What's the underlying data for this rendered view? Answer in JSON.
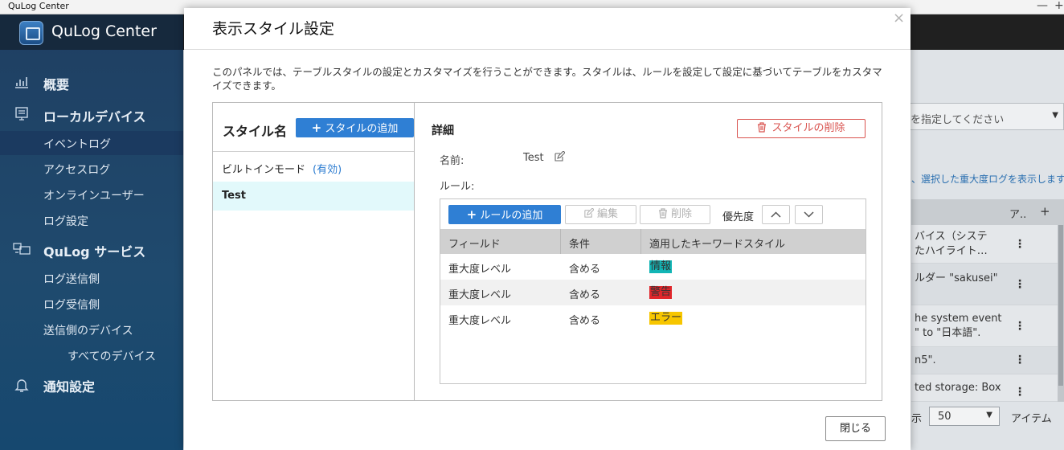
{
  "window": {
    "title": "QuLog Center",
    "minimize": "—",
    "maximize": "+"
  },
  "app": {
    "name": "QuLog Center"
  },
  "sidebar": {
    "groups": [
      {
        "label": "概要",
        "icon": "bar-chart-icon"
      },
      {
        "label": "ローカルデバイス",
        "icon": "local-device-icon"
      },
      {
        "label": "QuLog サービス",
        "icon": "qulog-service-icon"
      },
      {
        "label": "通知設定",
        "icon": "bell-icon"
      }
    ],
    "items": [
      {
        "label": "イベントログ"
      },
      {
        "label": "アクセスログ"
      },
      {
        "label": "オンラインユーザー"
      },
      {
        "label": "ログ設定"
      },
      {
        "label": "ログ送信側"
      },
      {
        "label": "ログ受信側"
      },
      {
        "label": "送信側のデバイス"
      },
      {
        "label": "すべてのデバイス"
      }
    ]
  },
  "background": {
    "select_text": "を指定してください",
    "hint": "、選択した重大度ログを表示します。",
    "col_action": "ア..",
    "col_add": "+",
    "rows": [
      {
        "line1": "バイス（システ",
        "line2": "たハイライト…"
      },
      {
        "line1": "ルダー \"sakusei\"",
        "line2": ""
      },
      {
        "line1": "he system event",
        "line2": "\" to \"日本語\"."
      },
      {
        "line1": "n5\".",
        "line2": ""
      },
      {
        "line1": "ted storage: Box",
        "line2": ""
      }
    ],
    "footer": {
      "label_show": "示",
      "page_size": "50",
      "label_items": "アイテム"
    }
  },
  "dialog": {
    "title": "表示スタイル設定",
    "close_glyph": "×",
    "description": "このパネルでは、テーブルスタイルの設定とカスタマイズを行うことができます。スタイルは、ルールを設定して設定に基づいてテーブルをカスタマイズできます。",
    "styles_header": "スタイル名",
    "add_style_label": "スタイルの追加",
    "styles": [
      {
        "name": "ビルトインモード",
        "tag": "(有効)"
      },
      {
        "name": "Test",
        "tag": ""
      }
    ],
    "details_header": "詳細",
    "delete_style_label": "スタイルの削除",
    "name_label": "名前:",
    "name_value": "Test",
    "rules_label": "ルール:",
    "toolbar": {
      "add_rule": "ルールの追加",
      "edit": "編集",
      "remove": "削除",
      "priority": "優先度"
    },
    "columns": [
      "フィールド",
      "条件",
      "適用したキーワードスタイル"
    ],
    "rules": [
      {
        "field": "重大度レベル",
        "condition": "含める",
        "keyword": "情報",
        "bg": "#12b5b5"
      },
      {
        "field": "重大度レベル",
        "condition": "含める",
        "keyword": "警告",
        "bg": "#e0262b"
      },
      {
        "field": "重大度レベル",
        "condition": "含める",
        "keyword": "エラー",
        "bg": "#f7c600"
      }
    ],
    "close_button": "閉じる"
  },
  "colors": {
    "accent": "#2f7fd4",
    "danger": "#d9534f",
    "selected_row": "#e2f9fb"
  }
}
